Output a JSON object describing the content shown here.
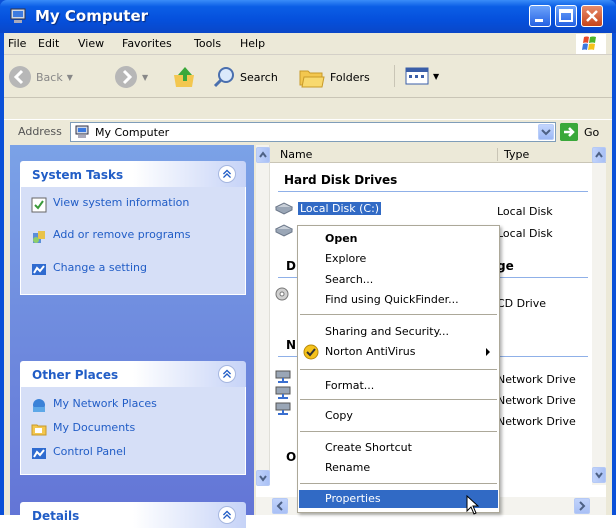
{
  "window": {
    "title": "My Computer"
  },
  "menubar": {
    "file": "File",
    "edit": "Edit",
    "view": "View",
    "favorites": "Favorites",
    "tools": "Tools",
    "help": "Help"
  },
  "toolbar": {
    "back": "Back",
    "search": "Search",
    "folders": "Folders"
  },
  "address": {
    "label": "Address",
    "value": "My Computer",
    "go": "Go"
  },
  "system_tasks": {
    "title": "System Tasks",
    "items": [
      "View system information",
      "Add or remove programs",
      "Change a setting"
    ]
  },
  "other_places": {
    "title": "Other Places",
    "items": [
      "My Network Places",
      "My Documents",
      "Control Panel"
    ]
  },
  "details": {
    "title": "Details"
  },
  "columns": {
    "name": "Name",
    "type": "Type"
  },
  "groups": {
    "hard_disk": "Hard Disk Drives",
    "removable_fragment": "ge",
    "d_fragment": "D",
    "n_fragment": "N",
    "o_fragment": "O"
  },
  "files": {
    "local_c": {
      "name": "Local Disk (C:)",
      "type": "Local Disk"
    },
    "local_2": {
      "type": "Local Disk"
    },
    "cd": {
      "type": "CD Drive"
    },
    "net1": {
      "type": "Network Drive"
    },
    "net2": {
      "type": "Network Drive"
    },
    "net3": {
      "type": "Network Drive"
    }
  },
  "context_menu": {
    "open": "Open",
    "explore": "Explore",
    "search": "Search...",
    "quickfinder": "Find using QuickFinder...",
    "sharing": "Sharing and Security...",
    "norton": "Norton AntiVirus",
    "format": "Format...",
    "copy": "Copy",
    "create_shortcut": "Create Shortcut",
    "rename": "Rename",
    "properties": "Properties"
  }
}
